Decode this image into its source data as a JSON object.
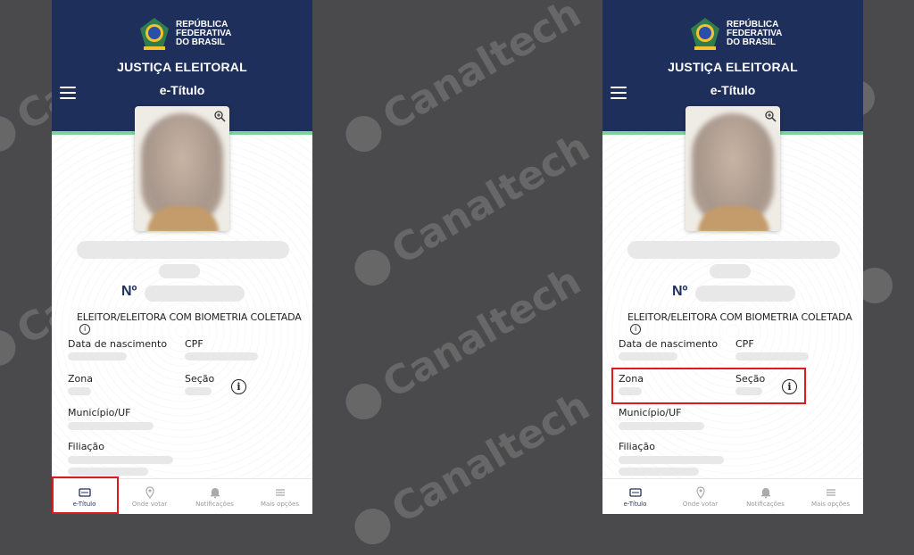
{
  "watermark": "Canaltech",
  "header": {
    "republic_lines": [
      "REPÚBLICA",
      "FEDERATIVA",
      "DO BRASIL"
    ],
    "title": "JUSTIÇA ELEITORAL",
    "subtitle": "e-Título"
  },
  "card": {
    "number_label": "Nº",
    "biometria_text": "ELEITOR/ELEITORA COM BIOMETRIA COLETADA",
    "fields": {
      "data_nascimento": "Data de nascimento",
      "cpf": "CPF",
      "zona": "Zona",
      "secao": "Seção",
      "municipio": "Município/UF",
      "filiacao": "Filiação"
    },
    "info_glyph": "i"
  },
  "bottom_nav": [
    {
      "label": "e-Título",
      "icon": "card-icon",
      "active": true
    },
    {
      "label": "Onde votar",
      "icon": "location-pin-icon",
      "active": false
    },
    {
      "label": "Notificações",
      "icon": "bell-icon",
      "active": false
    },
    {
      "label": "Mais opções",
      "icon": "menu-lines-icon",
      "active": false
    }
  ],
  "colors": {
    "header_bg": "#1f2f5b",
    "accent_green": "#7fd39a",
    "highlight_red": "#e0191e",
    "background": "#4a4a4c"
  },
  "highlights": {
    "left_phone": "bottom-nav e-Título",
    "right_phone": "Zona / Seção row"
  }
}
